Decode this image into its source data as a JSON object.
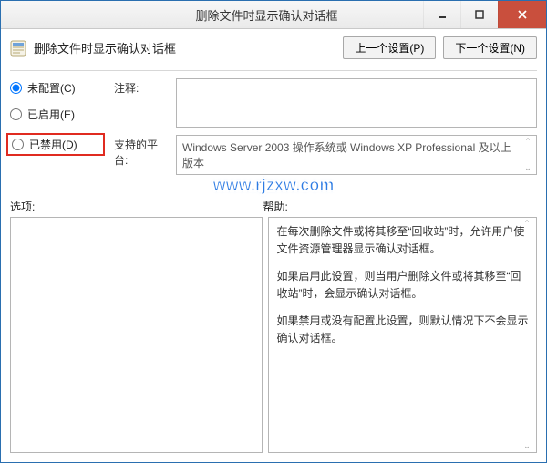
{
  "title_bar": {
    "title": "删除文件时显示确认对话框"
  },
  "header": {
    "policy_title": "删除文件时显示确认对话框",
    "prev_button": "上一个设置(P)",
    "next_button": "下一个设置(N)"
  },
  "radios": {
    "not_configured": {
      "label": "未配置(C)",
      "checked": true
    },
    "enabled": {
      "label": "已启用(E)",
      "checked": false
    },
    "disabled": {
      "label": "已禁用(D)",
      "checked": false
    }
  },
  "info": {
    "comment_label": "注释:",
    "comment_value": "",
    "supported_label": "支持的平台:",
    "supported_value": "Windows Server 2003 操作系统或 Windows XP Professional 及以上版本"
  },
  "watermark": "www.rjzxw.com",
  "labels": {
    "options": "选项:",
    "help": "帮助:"
  },
  "help": {
    "p1": "在每次删除文件或将其移至“回收站”时，允许用户使文件资源管理器显示确认对话框。",
    "p2": "如果启用此设置，则当用户删除文件或将其移至“回收站”时，会显示确认对话框。",
    "p3": "如果禁用或没有配置此设置，则默认情况下不会显示确认对话框。"
  }
}
